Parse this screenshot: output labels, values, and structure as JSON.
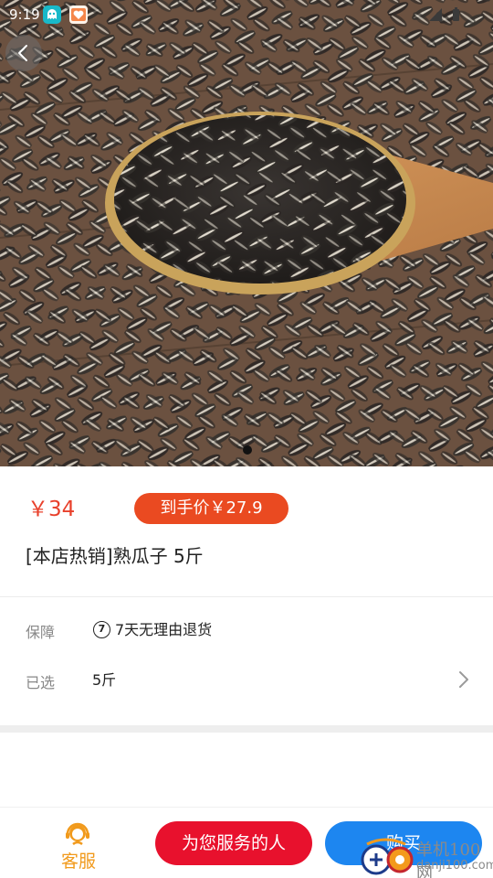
{
  "status_bar": {
    "time": "9:19",
    "app_icons": [
      "ghost-app-icon",
      "heart-app-icon"
    ],
    "indicators": [
      "signal-icon",
      "battery-icon"
    ]
  },
  "hero": {
    "image_description_icon": "sunflower-seeds-photo",
    "pager": {
      "current": 1,
      "total": 1
    }
  },
  "product": {
    "price": "￥34",
    "deal_price": "到手价￥27.9",
    "title": "[本店热销]熟瓜子 5斤"
  },
  "info_rows": {
    "guarantee_label": "保障",
    "guarantee_icon_text": "7",
    "guarantee_text": "7天无理由退货",
    "selected_label": "已选",
    "selected_value": "5斤"
  },
  "bottom_bar": {
    "service_label": "客服",
    "serve_button": "为您服务的人",
    "buy_button": "购买"
  },
  "watermark": {
    "name": "单机100网",
    "url": "danji100.com"
  },
  "colors": {
    "price_red": "#e8402b",
    "deal_badge": "#ea4a21",
    "serve_button": "#e8112d",
    "buy_button": "#1d86f0",
    "service_orange": "#f19a1c"
  }
}
